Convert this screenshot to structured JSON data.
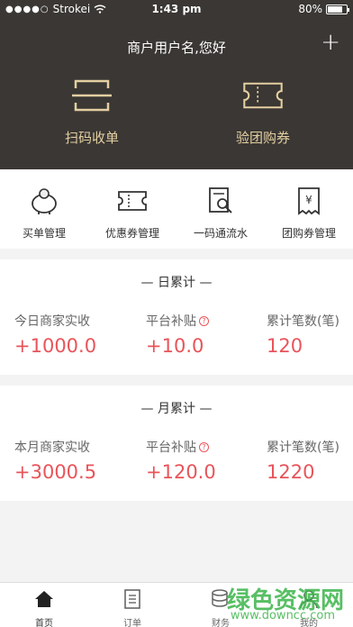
{
  "status": {
    "carrier": "Strokei",
    "time": "1:43 pm",
    "battery": "80%",
    "battery_level": 0.8
  },
  "header": {
    "title": "商户用户名,您好",
    "add_icon": "plus-icon"
  },
  "actions": [
    {
      "label": "扫码收单",
      "icon": "scan-icon"
    },
    {
      "label": "验团购券",
      "icon": "ticket-icon"
    }
  ],
  "menu": [
    {
      "label": "买单管理",
      "icon": "piggy-bank-icon"
    },
    {
      "label": "优惠券管理",
      "icon": "coupon-icon"
    },
    {
      "label": "一码通流水",
      "icon": "search-document-icon"
    },
    {
      "label": "团购券管理",
      "icon": "yen-receipt-icon"
    }
  ],
  "daily": {
    "title": "— 日累计 —",
    "cols": [
      {
        "label": "今日商家实收",
        "value": "+1000.0"
      },
      {
        "label": "平台补贴",
        "value": "+10.0"
      },
      {
        "label": "累计笔数(笔)",
        "value": "120"
      }
    ]
  },
  "monthly": {
    "title": "— 月累计 —",
    "cols": [
      {
        "label": "本月商家实收",
        "value": "+3000.5"
      },
      {
        "label": "平台补贴",
        "value": "+120.0"
      },
      {
        "label": "累计笔数(笔)",
        "value": "1220"
      }
    ]
  },
  "tabs": [
    {
      "label": "首页",
      "icon": "home-icon"
    },
    {
      "label": "订单",
      "icon": "order-list-icon"
    },
    {
      "label": "财务",
      "icon": "finance-icon"
    },
    {
      "label": "我的",
      "icon": "user-icon"
    }
  ],
  "help_glyph": "?",
  "watermark": {
    "text": "绿色资源网",
    "url": "www.downcc.com"
  },
  "colors": {
    "header_bg": "#3a3734",
    "accent_gold": "#e4cfa2",
    "value_red": "#e8545a"
  }
}
